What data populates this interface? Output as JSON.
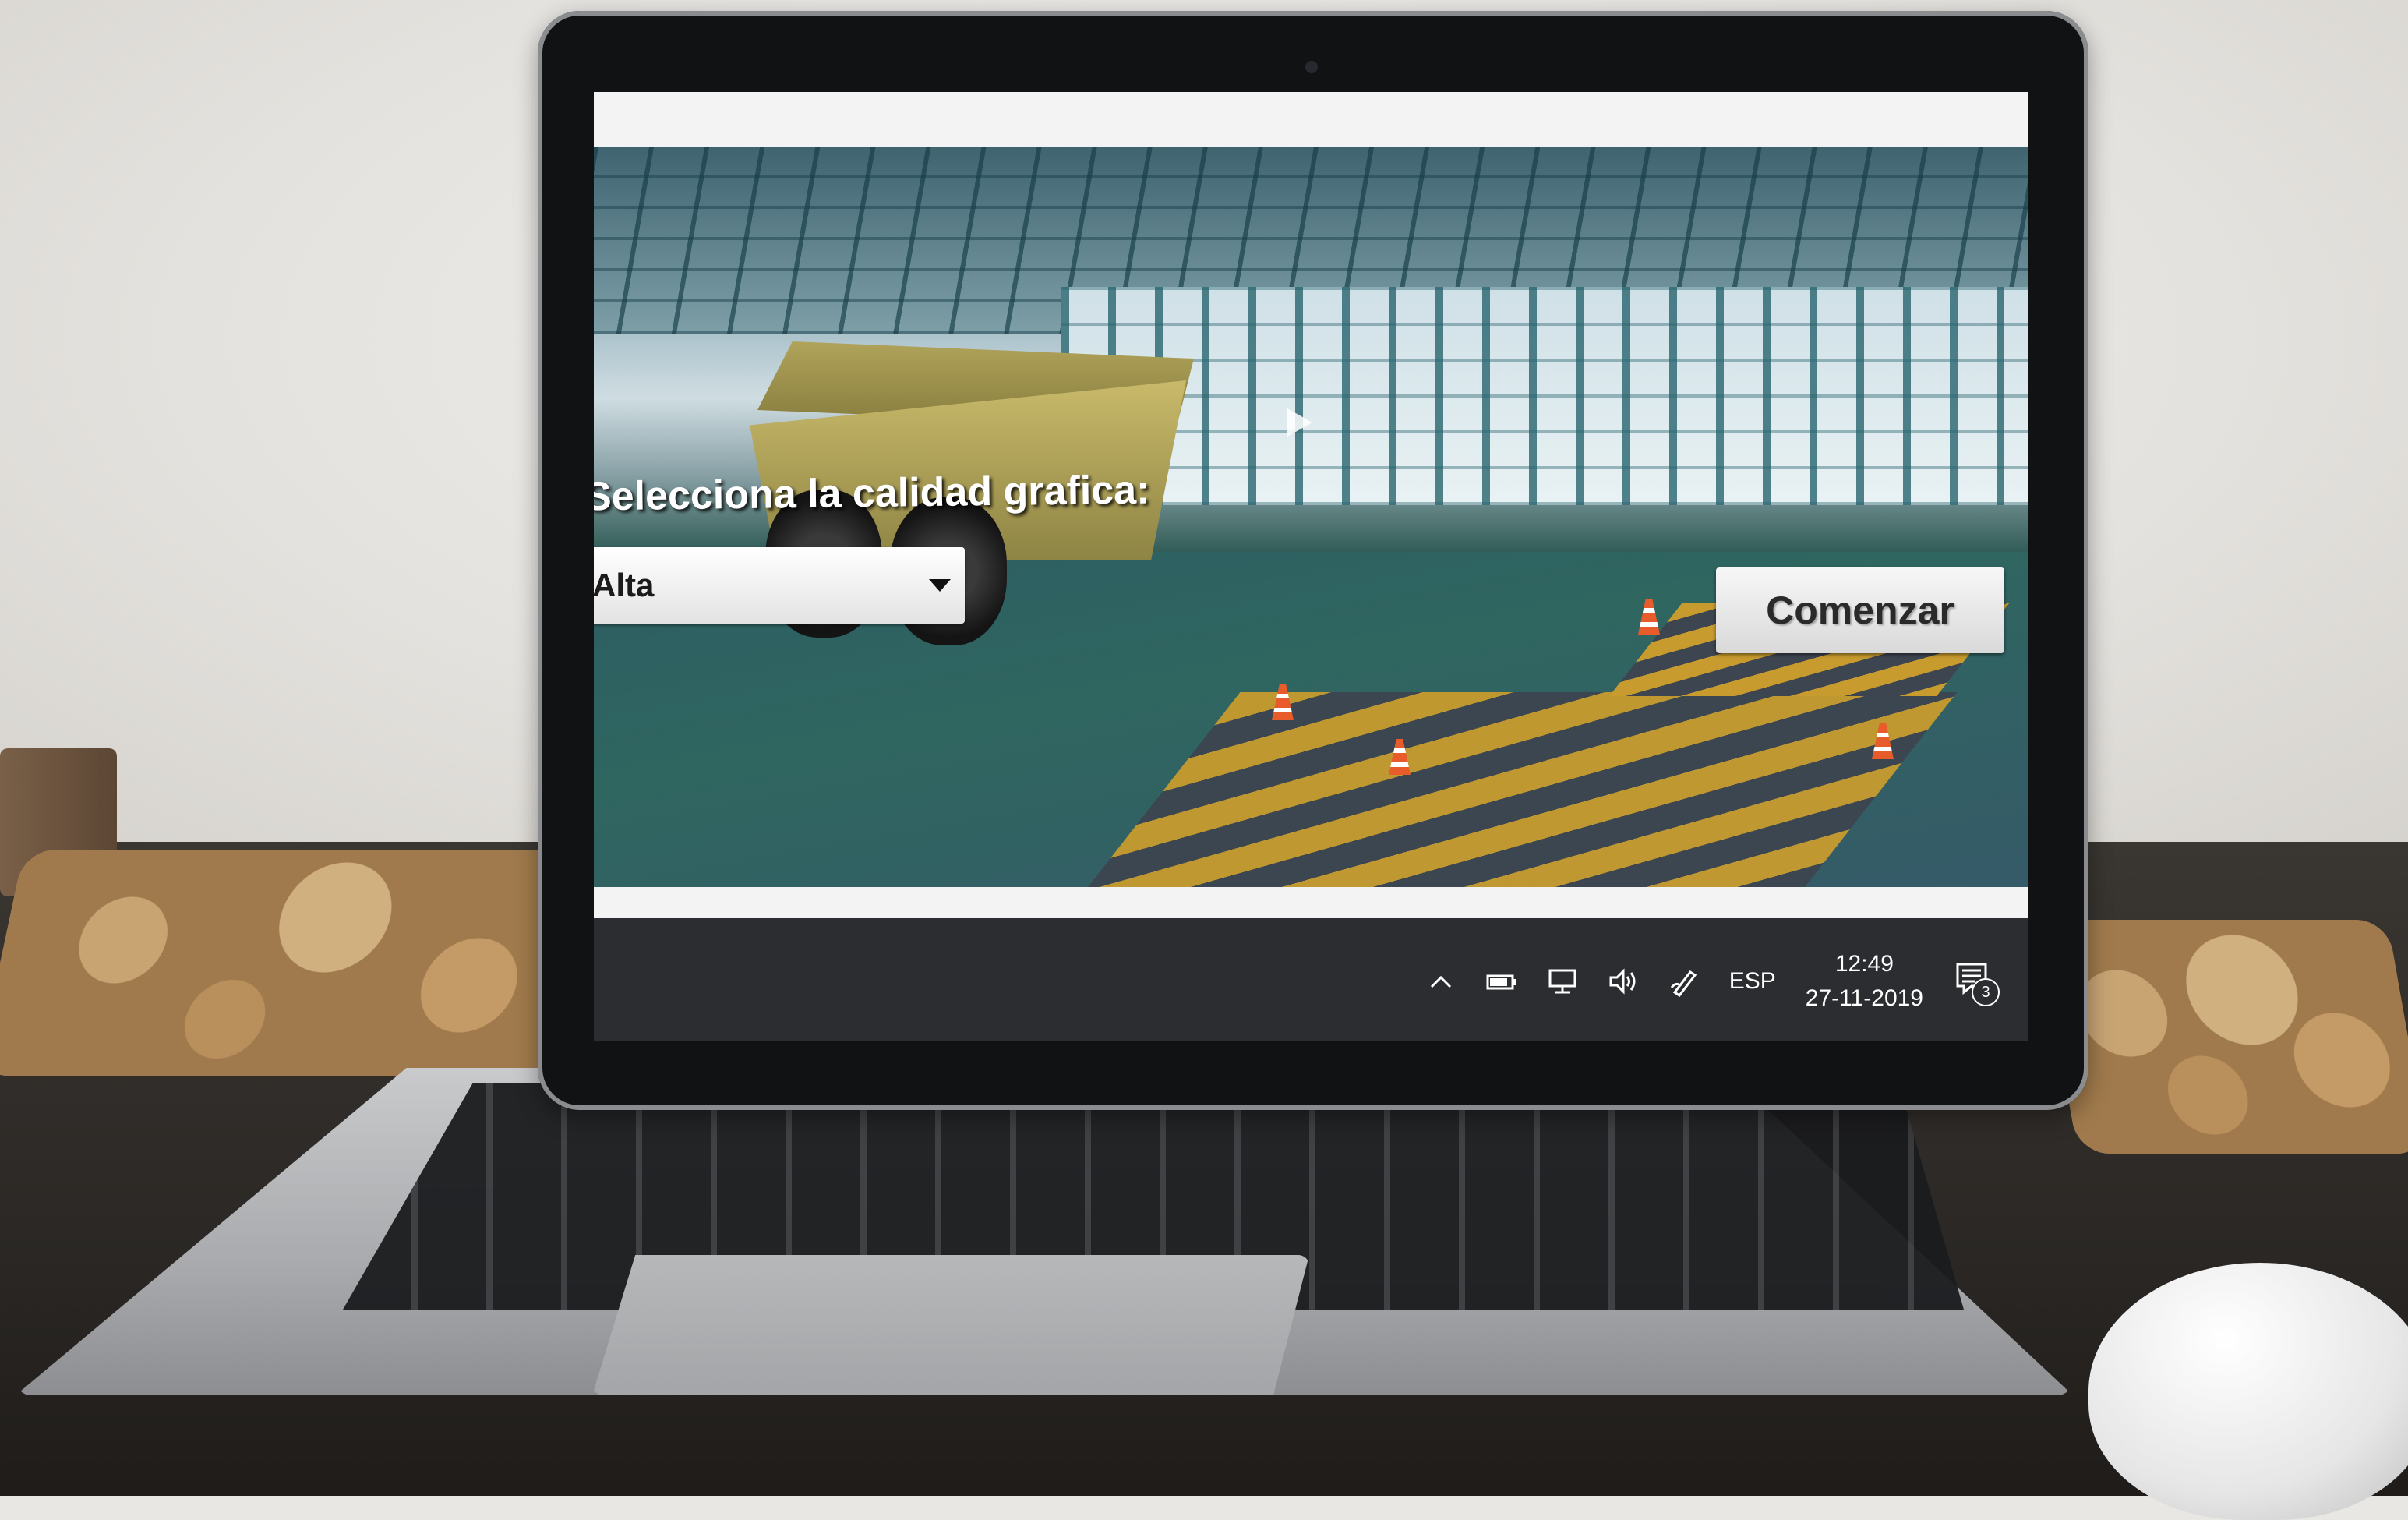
{
  "game": {
    "quality_prompt": "Selecciona la calidad grafica:",
    "quality_selected": "Alta",
    "start_button_label": "Comenzar"
  },
  "taskbar": {
    "language": "ESP",
    "time": "12:49",
    "date": "27-11-2019",
    "notification_count": "3",
    "icons": [
      "chevron-up-icon",
      "battery-icon",
      "network-icon",
      "volume-icon",
      "pen-icon",
      "notification-icon"
    ]
  }
}
